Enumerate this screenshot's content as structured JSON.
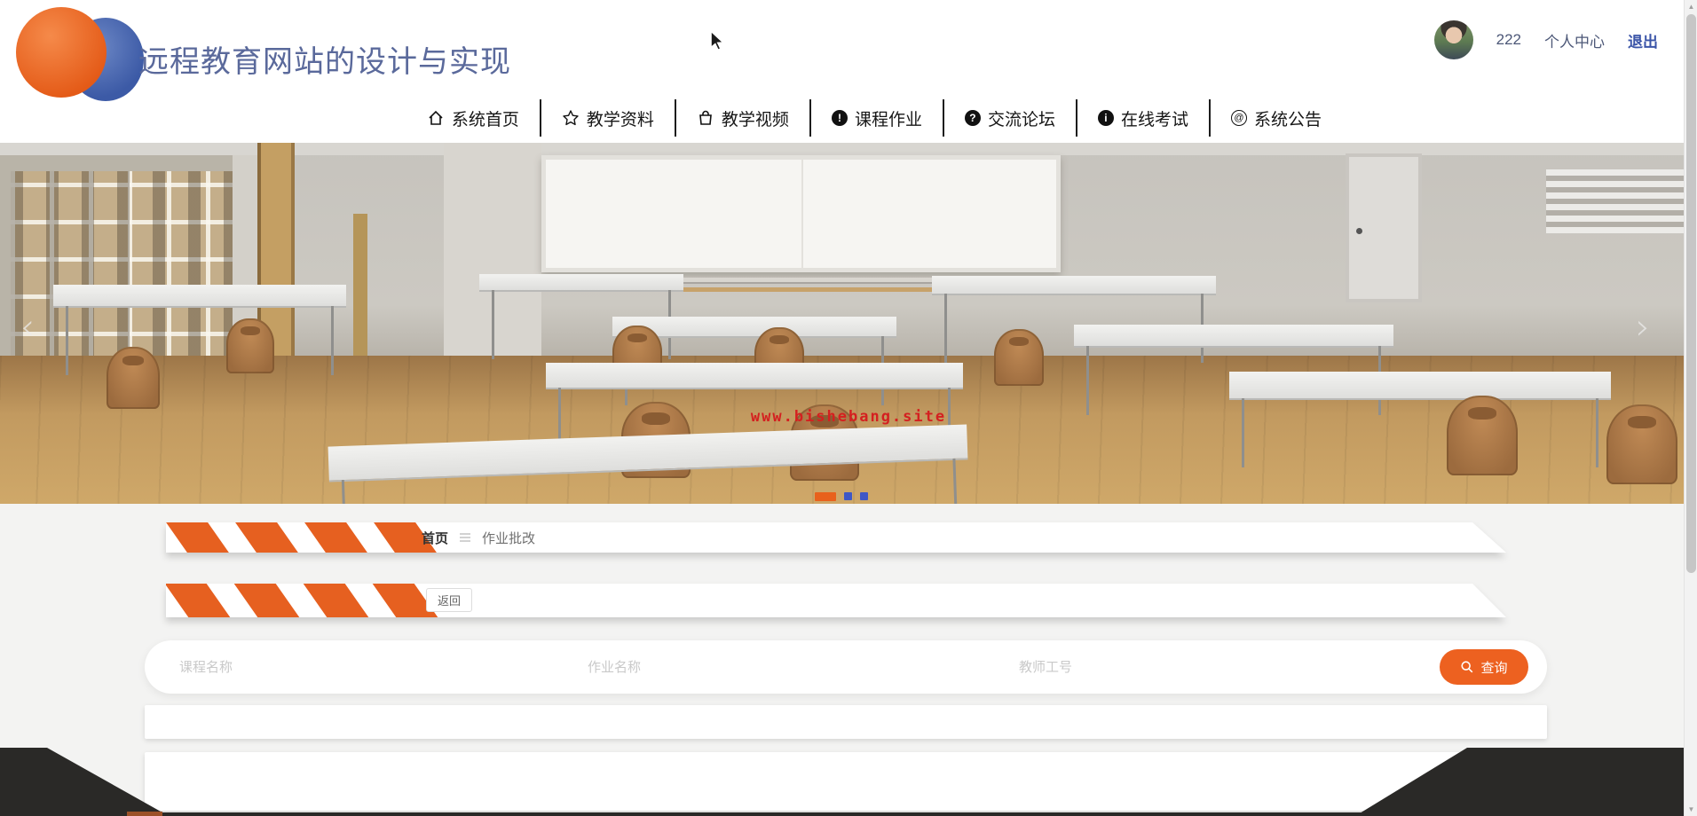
{
  "header": {
    "title": "远程教育网站的设计与实现",
    "user": {
      "username": "222",
      "profile_label": "个人中心",
      "logout_label": "退出"
    }
  },
  "nav": {
    "items": [
      {
        "label": "系统首页",
        "icon": "home-icon"
      },
      {
        "label": "教学资料",
        "icon": "star-icon"
      },
      {
        "label": "教学视频",
        "icon": "bag-icon"
      },
      {
        "label": "课程作业",
        "icon": "exclamation-circle-icon"
      },
      {
        "label": "交流论坛",
        "icon": "question-circle-icon"
      },
      {
        "label": "在线考试",
        "icon": "info-circle-icon"
      },
      {
        "label": "系统公告",
        "icon": "at-circle-icon"
      }
    ]
  },
  "hero": {
    "watermark": "www.bishebang.site",
    "carousel": {
      "slide_count": 3,
      "active_index": 0
    }
  },
  "breadcrumb": {
    "home": "首页",
    "current": "作业批改"
  },
  "toolbar": {
    "back_label": "返回"
  },
  "search": {
    "course_placeholder": "课程名称",
    "assignment_placeholder": "作业名称",
    "teacher_placeholder": "教师工号",
    "submit_label": "查询"
  },
  "icon_glyphs": {
    "exclamation": "!",
    "question": "?",
    "info": "i",
    "at": "@"
  },
  "colors": {
    "accent_orange": "#e66020",
    "button_orange": "#ed6120",
    "logo_blue": "#3c5aa6",
    "title_blue": "#5a699b",
    "watermark_red": "#d42020",
    "indicator_blue": "#3f57c6",
    "footer_dark": "#2a2927"
  }
}
